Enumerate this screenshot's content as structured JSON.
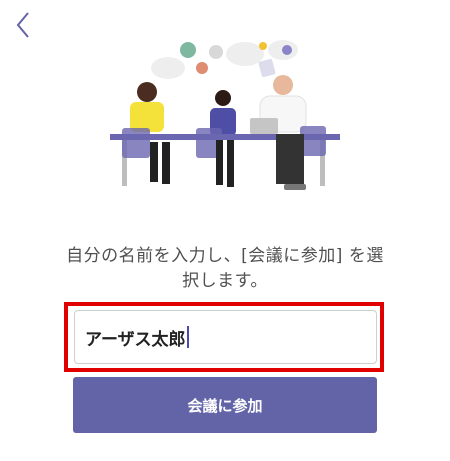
{
  "header": {
    "back_icon": "chevron-left-icon"
  },
  "main": {
    "illustration": "meeting-people-illustration",
    "instruction": "自分の名前を入力し、[会議に参加] を選択します。",
    "name_input": {
      "value": "アーザス太郎",
      "highlighted": true
    },
    "join_button_label": "会議に参加"
  },
  "colors": {
    "accent": "#6264a7",
    "highlight": "#e00000",
    "text": "#505050"
  }
}
